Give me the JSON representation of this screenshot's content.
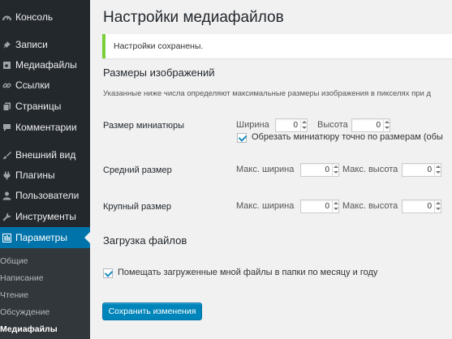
{
  "sidebar": {
    "items": [
      {
        "label": "Консоль",
        "icon": "dashboard-icon"
      },
      {
        "label": "Записи",
        "icon": "pin-icon"
      },
      {
        "label": "Медиафайлы",
        "icon": "media-icon"
      },
      {
        "label": "Ссылки",
        "icon": "link-icon"
      },
      {
        "label": "Страницы",
        "icon": "pages-icon"
      },
      {
        "label": "Комментарии",
        "icon": "comment-icon"
      },
      {
        "label": "Внешний вид",
        "icon": "brush-icon"
      },
      {
        "label": "Плагины",
        "icon": "plugin-icon"
      },
      {
        "label": "Пользователи",
        "icon": "user-icon"
      },
      {
        "label": "Инструменты",
        "icon": "wrench-icon"
      },
      {
        "label": "Параметры",
        "icon": "settings-icon"
      }
    ],
    "submenu": [
      "Общие",
      "Написание",
      "Чтение",
      "Обсуждение",
      "Медиафайлы"
    ]
  },
  "page": {
    "title": "Настройки медиафайлов",
    "notice": "Настройки сохранены.",
    "sizes_title": "Размеры изображений",
    "sizes_desc": "Указанные ниже числа определяют максимальные размеры изображения в пикселях при д",
    "thumbnail": {
      "label": "Размер миниатюры",
      "width_label": "Ширина",
      "width": "0",
      "height_label": "Высота",
      "height": "0",
      "crop_label": "Обрезать миниатюру точно по размерам (обы"
    },
    "medium": {
      "label": "Средний размер",
      "width_label": "Макс. ширина",
      "width": "0",
      "height_label": "Макс. высота",
      "height": "0"
    },
    "large": {
      "label": "Крупный размер",
      "width_label": "Макс. ширина",
      "width": "0",
      "height_label": "Макс. высота",
      "height": "0"
    },
    "upload_title": "Загрузка файлов",
    "organize_label": "Помещать загруженные мной файлы в папки по месяцу и году",
    "save_label": "Сохранить изменения"
  },
  "colors": {
    "sidebar_bg": "#23282d",
    "accent": "#0073aa",
    "notice_border": "#7ad03a",
    "button": "#0085ba"
  }
}
